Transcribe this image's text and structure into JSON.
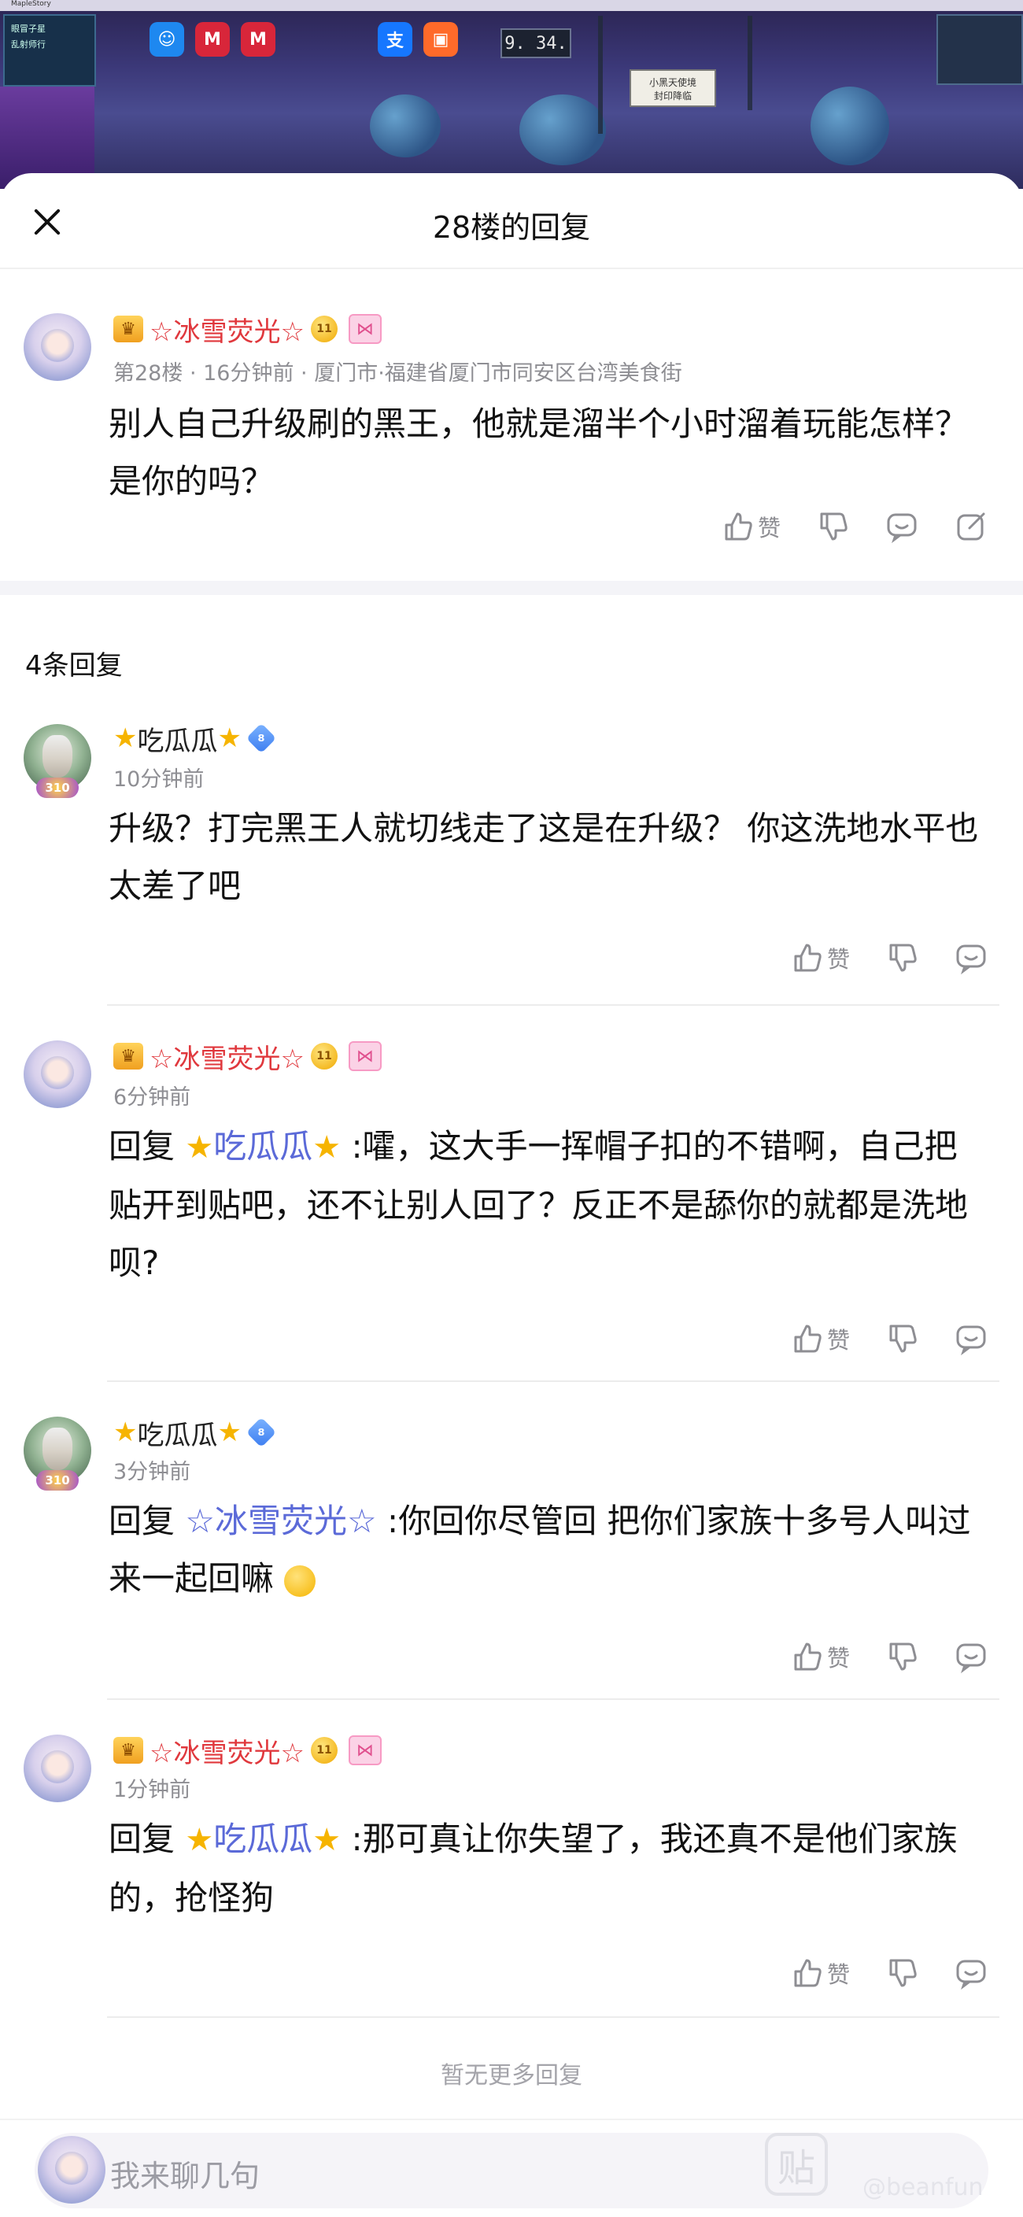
{
  "sheet": {
    "title": "28楼的回复",
    "close_icon": "close-icon"
  },
  "main_post": {
    "username": "☆冰雪荧光☆",
    "level_badge": "11",
    "meta": "第28楼 · 16分钟前 · 厦门市·福建省厦门市同安区台湾美食街",
    "content": "别人自己升级刷的黑王，他就是溜半个小时溜着玩能怎样？是你的吗？",
    "like_label": "赞"
  },
  "replies_count": "4条回复",
  "replies": [
    {
      "username": "吃瓜瓜",
      "level_badge": "8",
      "avatar_level": "310",
      "time": "10分钟前",
      "prefix": "",
      "mention": "",
      "text": "升级？打完黑王人就切线走了这是在升级？ 你这洗地水平也太差了吧",
      "like_label": "赞"
    },
    {
      "username": "☆冰雪荧光☆",
      "level_badge": "11",
      "time": "6分钟前",
      "prefix": "回复",
      "mention": "吃瓜瓜",
      "text": ":嚯，这大手一挥帽子扣的不错啊，自己把贴开到贴吧，还不让别人回了？反正不是舔你的就都是洗地呗?",
      "like_label": "赞"
    },
    {
      "username": "吃瓜瓜",
      "level_badge": "8",
      "avatar_level": "310",
      "time": "3分钟前",
      "prefix": "回复",
      "mention": "☆冰雪荧光☆",
      "text": ":你回你尽管回 把你们家族十多号人叫过来一起回嘛",
      "like_label": "赞"
    },
    {
      "username": "☆冰雪荧光☆",
      "level_badge": "11",
      "time": "1分钟前",
      "prefix": "回复",
      "mention": "吃瓜瓜",
      "text": ":那可真让你失望了，我还真不是他们家族的，抢怪狗",
      "like_label": "赞"
    }
  ],
  "no_more": "暂无更多回复",
  "input": {
    "placeholder": "我来聊几句"
  },
  "watermark": {
    "text": "@beanfun",
    "glyph": "贴"
  },
  "background_game": {
    "window_title": "MapleStory",
    "clock": "9. 34.",
    "hud_line1": "眼冒子星",
    "hud_line2": "乱射师行",
    "sign_text1": "小黑天使境",
    "sign_text2": "封印降临"
  },
  "colors": {
    "username_red": "#e0383d",
    "mention_blue": "#5b6ad8",
    "meta_gray": "#8e8e93"
  }
}
